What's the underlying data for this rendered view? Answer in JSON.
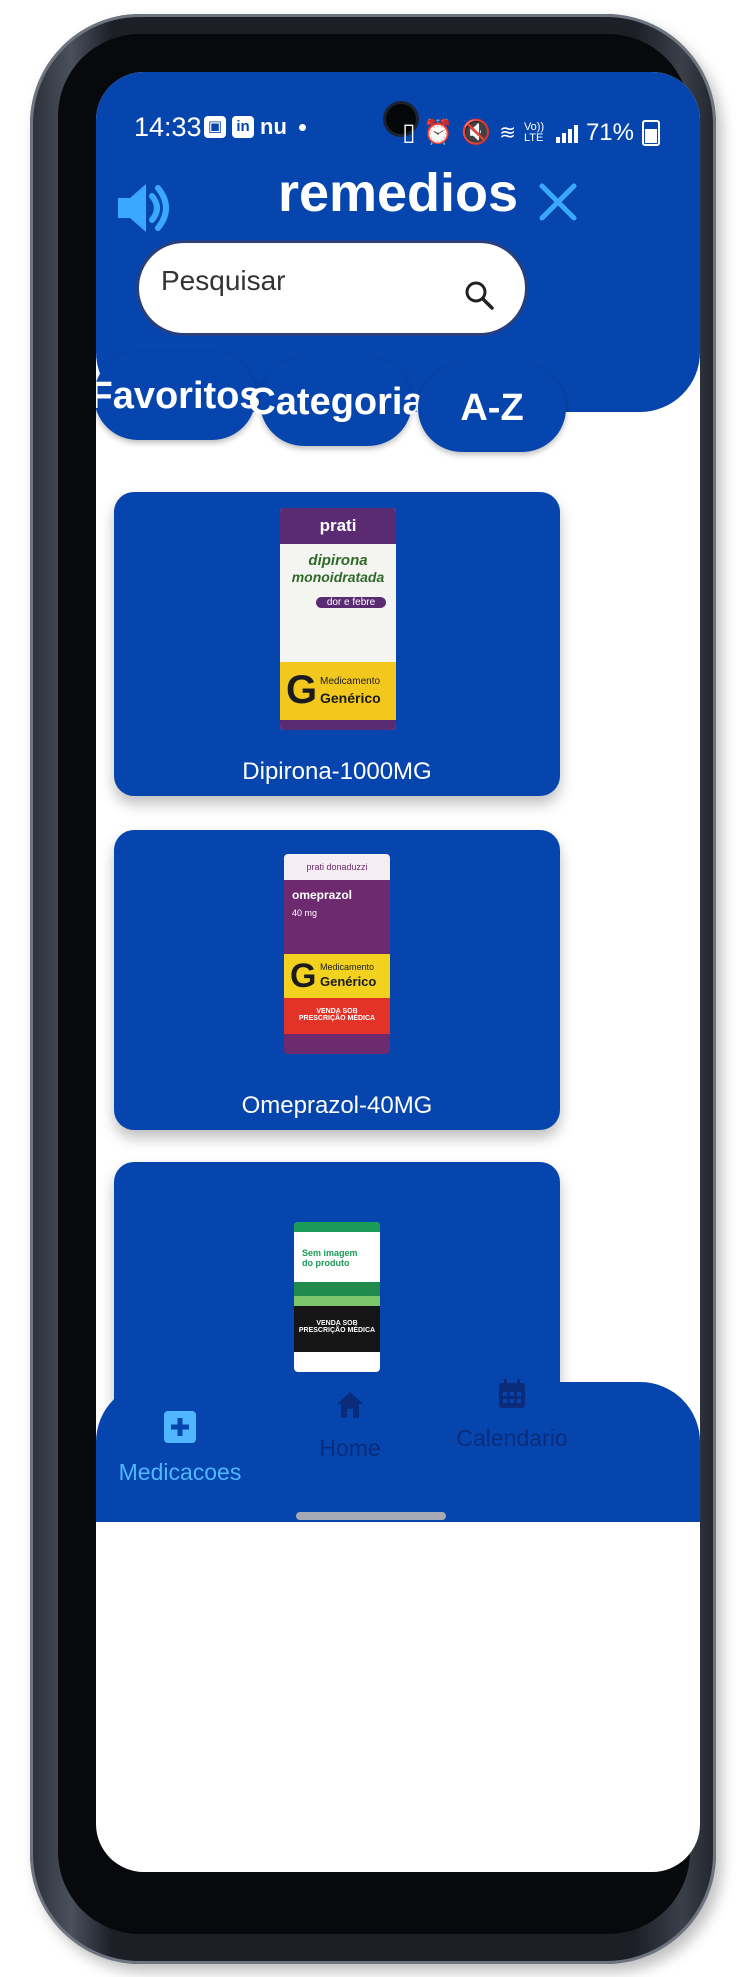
{
  "statusbar": {
    "time": "14:33",
    "left_icons": [
      "gallery-icon",
      "linkedin-icon"
    ],
    "left_text": "nu",
    "network_label": "Vo)) LTE",
    "battery": "71%"
  },
  "header": {
    "title": "remedios",
    "search_placeholder": "Pesquisar"
  },
  "filters": [
    "Favoritos",
    "Categoria",
    "A-Z"
  ],
  "medicines": [
    {
      "name": "Dipirona-1000MG",
      "box": {
        "brand": "prati",
        "product_lines": [
          "dipirona",
          "monoidratada"
        ],
        "badge": "dor e febre",
        "generic_lines": [
          "Medicamento",
          "Genérico"
        ]
      }
    },
    {
      "name": "Omeprazol-40MG",
      "box": {
        "brand": "prati donaduzzi",
        "product": "omeprazol",
        "dose": "40 mg",
        "generic_lines": [
          "Medicamento",
          "Genérico"
        ],
        "warning_lines": [
          "VENDA SOB",
          "PRESCRIÇÃO MÉDICA"
        ]
      }
    },
    {
      "name": "",
      "box": {
        "placeholder_lines": [
          "Sem imagem",
          "do produto"
        ],
        "warning_lines": [
          "VENDA SOB",
          "PRESCRIÇÃO MÉDICA"
        ]
      }
    }
  ],
  "bottom_nav": [
    {
      "label": "Medicacoes",
      "icon": "plus-square-icon",
      "active": true
    },
    {
      "label": "Home",
      "icon": "home-icon",
      "active": false
    },
    {
      "label": "Calendario",
      "icon": "calendar-icon",
      "active": false
    }
  ],
  "colors": {
    "primary": "#0645ad",
    "active_nav": "#4fb6ff",
    "inactive_nav": "#0b2c7a"
  }
}
